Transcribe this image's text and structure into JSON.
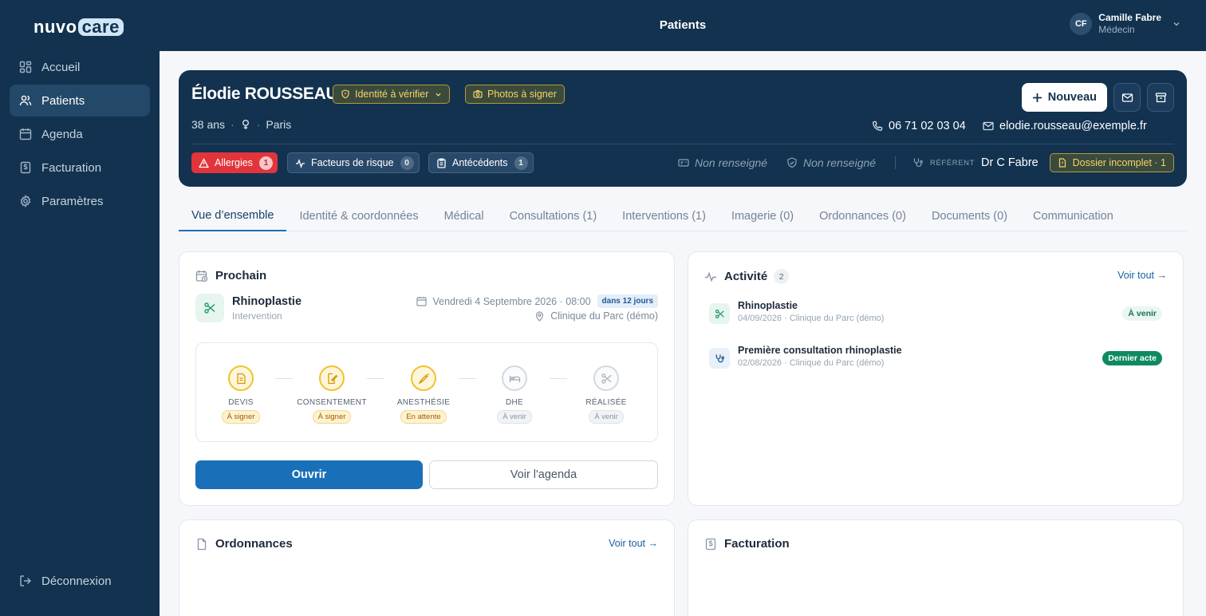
{
  "brand": {
    "name_part1": "nuvo",
    "name_part2": "care"
  },
  "sidebar": {
    "items": [
      {
        "label": "Accueil",
        "icon": "dashboard-icon"
      },
      {
        "label": "Patients",
        "icon": "users-icon"
      },
      {
        "label": "Agenda",
        "icon": "calendar-icon"
      },
      {
        "label": "Facturation",
        "icon": "receipt-icon"
      },
      {
        "label": "Paramètres",
        "icon": "gear-icon"
      }
    ],
    "active": "Patients",
    "logout_label": "Déconnexion"
  },
  "topbar": {
    "title": "Patients",
    "user": {
      "initials": "CF",
      "name": "Camille Fabre",
      "role": "Médecin"
    }
  },
  "patient": {
    "name": "Élodie ROUSSEAU",
    "identity_chip": "Identité à vérifier",
    "photos_chip": "Photos à signer",
    "age": "38 ans",
    "sex_icon": "female-icon",
    "city": "Paris",
    "phone": "06 71 02 03 04",
    "email": "elodie.rousseau@exemple.fr",
    "new_button": "Nouveau",
    "tags": {
      "allergies": {
        "label": "Allergies",
        "count": "1"
      },
      "risk": {
        "label": "Facteurs de risque",
        "count": "0"
      },
      "history": {
        "label": "Antécédents",
        "count": "1"
      }
    },
    "field1": "Non renseigné",
    "field2": "Non renseigné",
    "referent_label": "RÉFÉRENT",
    "referent_value": "Dr C Fabre",
    "incomplete_chip": "Dossier incomplet · 1"
  },
  "tabs": [
    "Vue d’ensemble",
    "Identité & coordonnées",
    "Médical",
    "Consultations (1)",
    "Interventions (1)",
    "Imagerie (0)",
    "Ordonnances (0)",
    "Documents (0)",
    "Communication"
  ],
  "next": {
    "title": "Prochain",
    "event_name": "Rhinoplastie",
    "event_type": "Intervention",
    "date": "Vendredi 4 Septembre 2026 · 08:00",
    "in_days": "dans 12 jours",
    "place": "Clinique du Parc (démo)",
    "steps": [
      {
        "label": "DEVIS",
        "status": "À signer",
        "state": "pending"
      },
      {
        "label": "CONSENTEMENT",
        "status": "À signer",
        "state": "pending"
      },
      {
        "label": "ANESTHÉSIE",
        "status": "En attente",
        "state": "pending"
      },
      {
        "label": "DHE",
        "status": "À venir",
        "state": "future"
      },
      {
        "label": "RÉALISÉE",
        "status": "À venir",
        "state": "future"
      }
    ],
    "open_button": "Ouvrir",
    "agenda_button": "Voir l'agenda"
  },
  "activity": {
    "title": "Activité",
    "count": "2",
    "see_all": "Voir tout →",
    "items": [
      {
        "title": "Rhinoplastie",
        "sub": "04/09/2026 · Clinique du Parc (démo)",
        "badge": "À venir"
      },
      {
        "title": "Première consultation rhinoplastie",
        "sub": "02/08/2026 · Clinique du Parc (démo)",
        "badge": "Dernier acte"
      }
    ]
  },
  "prescriptions": {
    "title": "Ordonnances",
    "see_all": "Voir tout →"
  },
  "billing": {
    "title": "Facturation"
  },
  "colors": {
    "navy": "#12324f",
    "primary": "#1a70b8",
    "danger": "#e2343b",
    "warning": "#f5d56b",
    "success": "#0f8a5f"
  }
}
